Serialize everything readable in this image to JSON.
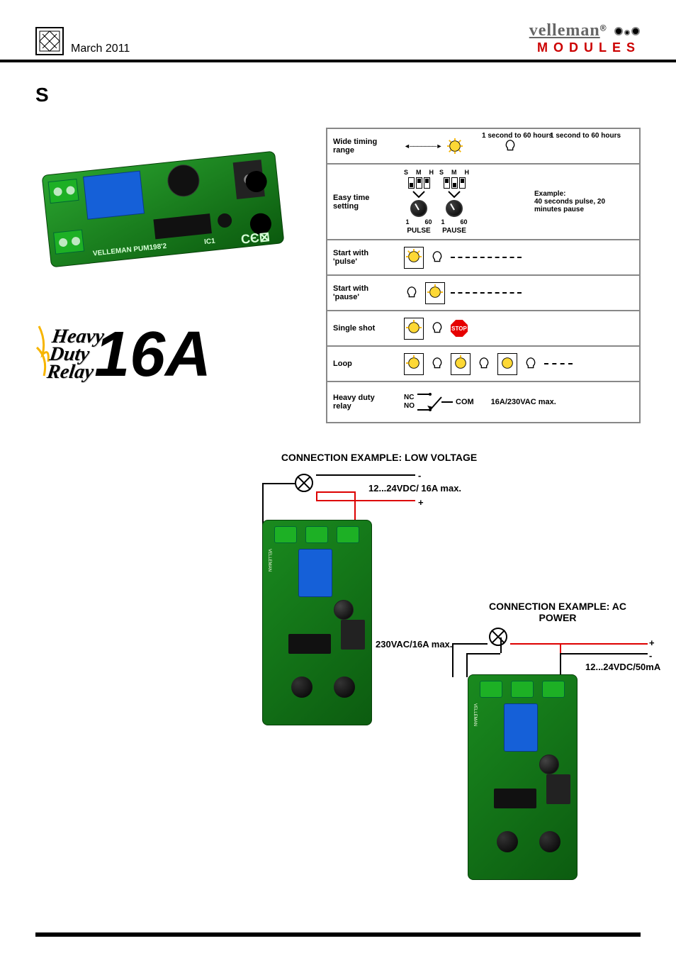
{
  "header": {
    "date": "March 2011",
    "logo_top": "velleman",
    "logo_reg": "®",
    "logo_bottom": "MODULES"
  },
  "heading_letter": "S",
  "heavy_duty": {
    "line1": "Heavy",
    "line2": "Duty",
    "line3": "Relay",
    "current": "16A"
  },
  "features": {
    "rows": [
      {
        "label": "Wide timing range",
        "range_text": "1 second to 60 hours",
        "range_text2": "1 second to 60 hours"
      },
      {
        "label": "Easy time setting",
        "switch_labels": "S  M  H",
        "knob_min": "1",
        "knob_max": "60",
        "pulse": "PULSE",
        "pause": "PAUSE",
        "example_title": "Example:",
        "example_text": "40 seconds pulse, 20 minutes pause"
      },
      {
        "label": "Start with 'pulse'"
      },
      {
        "label": "Start with 'pause'"
      },
      {
        "label": "Single shot",
        "stop": "STOP"
      },
      {
        "label": "Loop"
      },
      {
        "label": "Heavy duty relay",
        "nc": "NC",
        "no": "NO",
        "com": "COM",
        "rating": "16A/230VAC max."
      }
    ]
  },
  "connections": {
    "lv_title": "CONNECTION EXAMPLE: LOW VOLTAGE",
    "lv_minus": "-",
    "lv_rating": "12...24VDC/ 16A max.",
    "lv_plus": "+",
    "ac_title": "CONNECTION EXAMPLE: AC POWER",
    "ac_rating": "230VAC/16A max.",
    "ac_plus": "+",
    "ac_minus": "-",
    "ac_supply": "12...24VDC/50mA"
  }
}
